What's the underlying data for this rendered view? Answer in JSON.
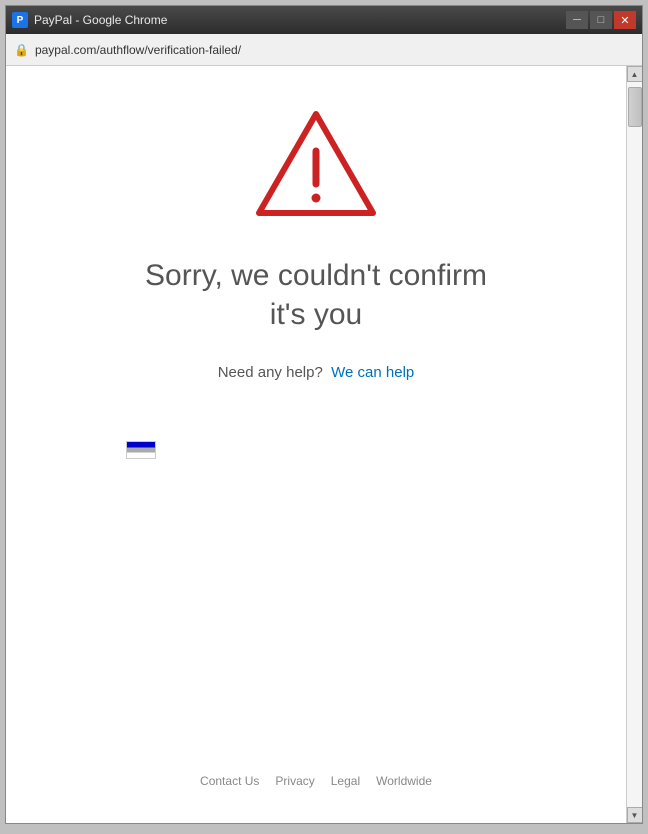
{
  "window": {
    "title": "PayPal - Google Chrome",
    "icon_label": "P",
    "minimize_label": "─",
    "maximize_label": "□",
    "close_label": "✕"
  },
  "addressbar": {
    "url": "paypal.com/authflow/verification-failed/",
    "lock_symbol": "🔒"
  },
  "page": {
    "heading": "Sorry, we couldn't confirm it's you",
    "help_text": "Need any help?",
    "help_link_text": "We can help",
    "footer": {
      "contact": "Contact Us",
      "privacy": "Privacy",
      "legal": "Legal",
      "worldwide": "Worldwide"
    }
  }
}
